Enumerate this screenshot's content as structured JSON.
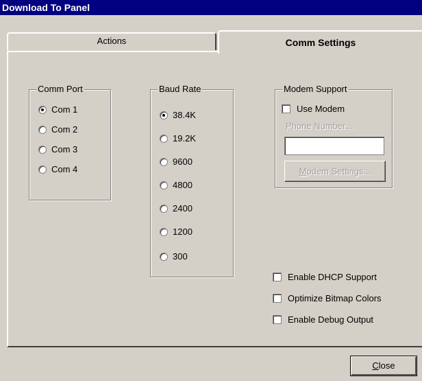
{
  "window": {
    "title": "Download To Panel"
  },
  "tabs": {
    "actions": "Actions",
    "comm_settings": "Comm Settings"
  },
  "comm_port": {
    "label": "Comm Port",
    "options": [
      "Com 1",
      "Com 2",
      "Com 3",
      "Com 4"
    ],
    "selected": "Com 1"
  },
  "baud_rate": {
    "label": "Baud Rate",
    "options": [
      "38.4K",
      "19.2K",
      "9600",
      "4800",
      "2400",
      "1200",
      "300"
    ],
    "selected": "38.4K"
  },
  "modem": {
    "label": "Modem Support",
    "use_modem": "Use Modem",
    "use_modem_checked": false,
    "phone_placeholder": "Phone Number...",
    "phone_value": "",
    "settings_button": "Modem Settings..."
  },
  "options": {
    "dhcp": "Enable DHCP Support",
    "dhcp_checked": false,
    "optimize": "Optimize Bitmap Colors",
    "optimize_checked": false,
    "debug": "Enable Debug Output",
    "debug_checked": false
  },
  "footer": {
    "close_label": "Close"
  },
  "colors": {
    "titlebar": "#000080",
    "face": "#d4d0c8"
  }
}
